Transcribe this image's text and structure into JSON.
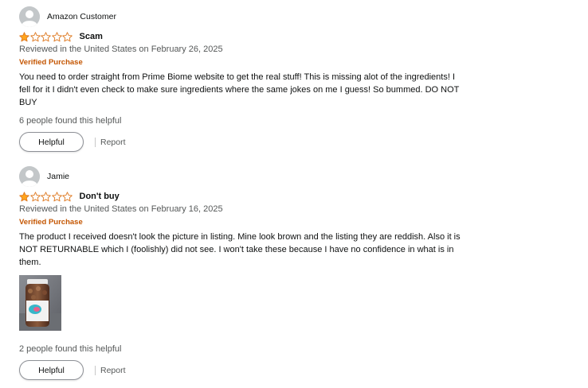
{
  "reviews": [
    {
      "author": "Amazon Customer",
      "rating": 1,
      "rating_max": 5,
      "title": "Scam",
      "meta": "Reviewed in the United States on February 26, 2025",
      "verified": "Verified Purchase",
      "body": "You need to order straight from Prime Biome website to get the real stuff! This is missing alot of the ingredients! I fell for it I didn't even check to make sure ingredients where the same jokes on me I guess! So bummed. DO NOT BUY",
      "helpful_count": "6 people found this helpful",
      "helpful_label": "Helpful",
      "report_label": "Report"
    },
    {
      "author": "Jamie",
      "rating": 1,
      "rating_max": 5,
      "title": "Don't buy",
      "meta": "Reviewed in the United States on February 16, 2025",
      "verified": "Verified Purchase",
      "body": "The product I received doesn't look the picture in listing. Mine look brown and the listing they are reddish. Also it is NOT RETURNABLE which I (foolishly) did not see. I won't take these because I have no confidence in what is in them.",
      "helpful_count": "2 people found this helpful",
      "helpful_label": "Helpful",
      "report_label": "Report"
    }
  ],
  "icons": {
    "avatar": "user-avatar-icon",
    "star_filled": "star-filled-icon",
    "star_empty": "star-empty-icon"
  },
  "colors": {
    "star": "#ffa41c",
    "star_outline": "#de7921",
    "verified": "#c45500",
    "meta_text": "#565959"
  }
}
